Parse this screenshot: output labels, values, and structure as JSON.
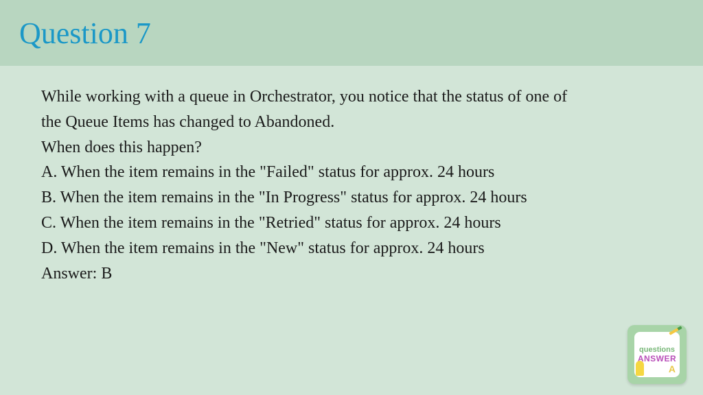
{
  "header": {
    "title": "Question 7"
  },
  "content": {
    "intro1": "While working with a queue in Orchestrator, you notice that the status of one of",
    "intro2": "the Queue Items has changed to Abandoned.",
    "prompt": "When does this happen?",
    "optionA": "A. When the item remains in the \"Failed\" status for approx. 24 hours",
    "optionB": "B. When the item remains in the \"In Progress\" status for approx. 24 hours",
    "optionC": "C. When the item remains in the \"Retried\" status for approx. 24 hours",
    "optionD": "D. When the item remains in the \"New\" status for approx. 24 hours",
    "answer": "Answer: B"
  },
  "badge": {
    "questions": "questions",
    "answer": "ANSWER",
    "letter": "A"
  }
}
